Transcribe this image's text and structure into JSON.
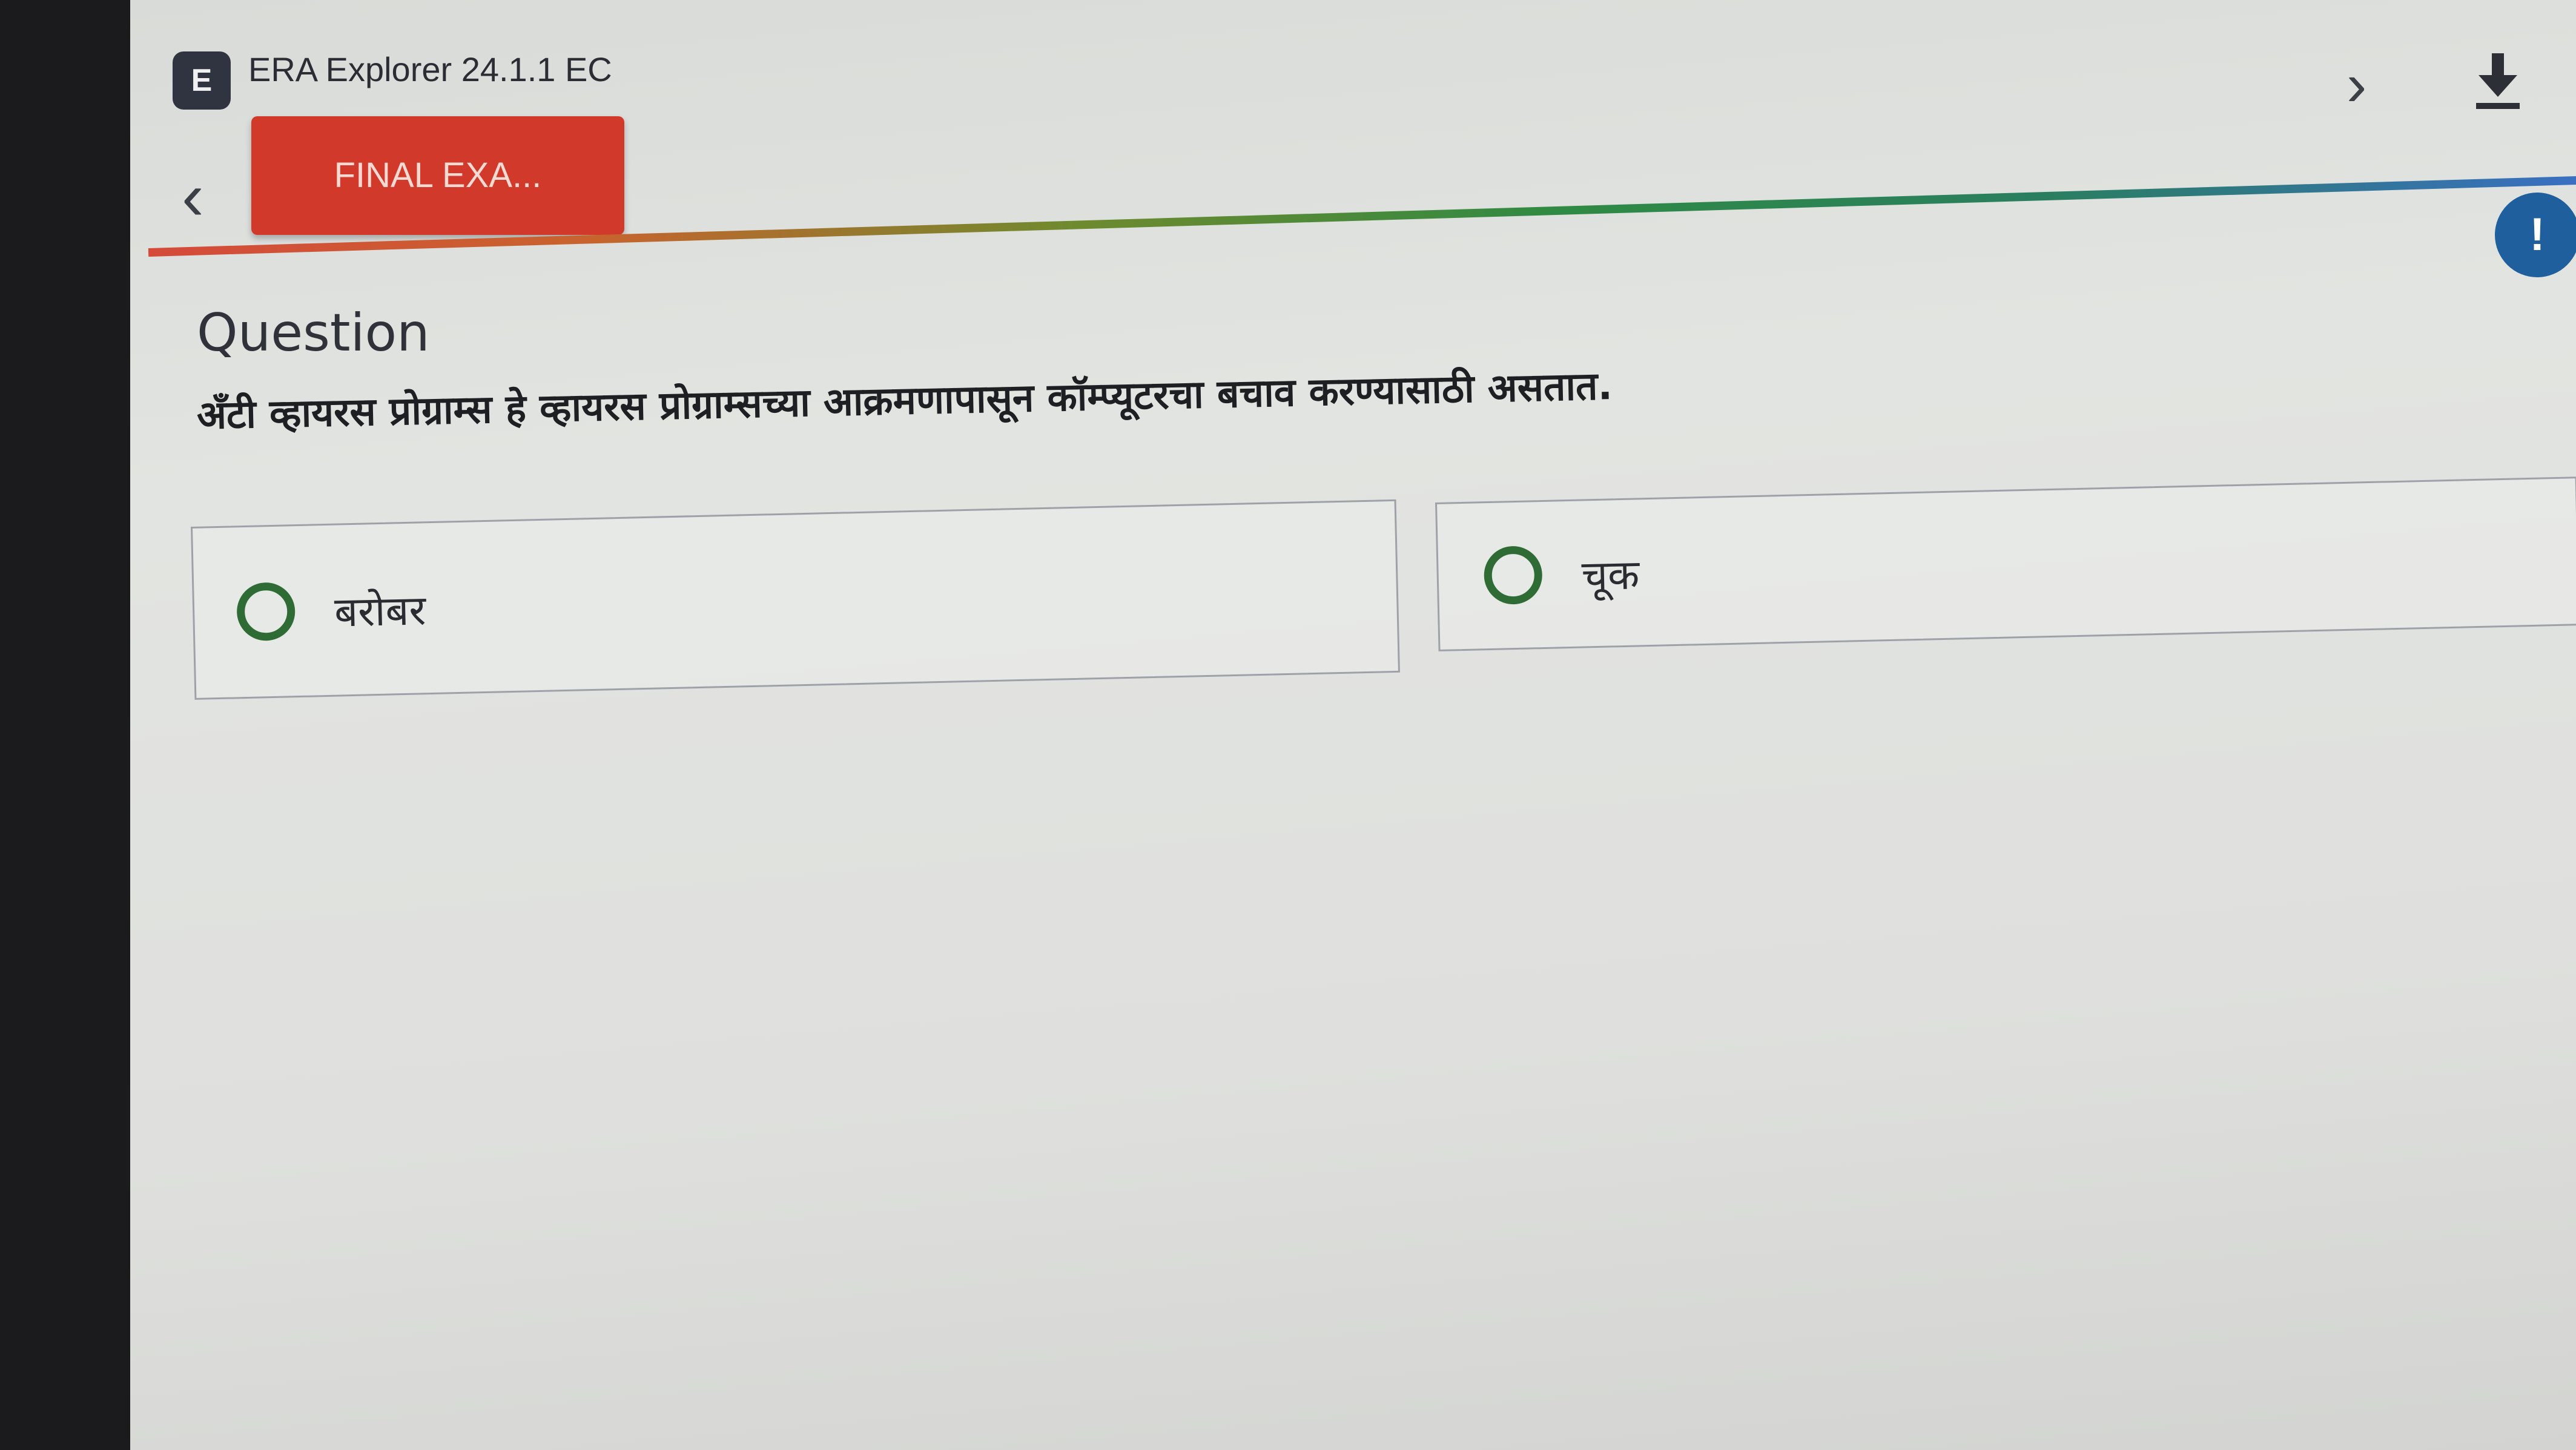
{
  "app": {
    "title": "ERA Explorer 24.1.1 EC",
    "logo_text": "E"
  },
  "nav": {
    "exam_tab_label": "FINAL EXA...",
    "back_icon": "chevron-left-icon",
    "next_icon": "chevron-right-icon",
    "download_icon": "download-icon",
    "info_icon_glyph": "!"
  },
  "question": {
    "heading": "Question",
    "text": "अँटी व्हायरस प्रोग्राम्स हे व्हायरस प्रोग्राम्सच्या आक्रमणापासून कॉम्प्यूटरचा बचाव करण्यासाठी असतात.",
    "options": [
      {
        "label": "बरोबर"
      },
      {
        "label": "चूक"
      }
    ]
  },
  "colors": {
    "exam_tab": "#d13a2a",
    "radio": "#2e6b35",
    "info": "#1f5f9e"
  }
}
